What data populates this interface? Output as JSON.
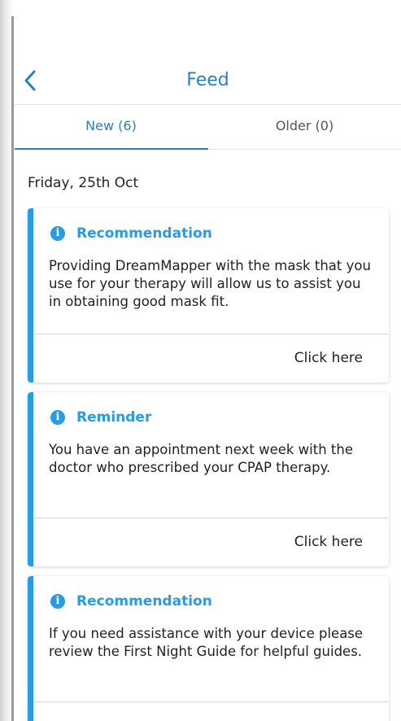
{
  "header": {
    "back_icon": "chevron-left-icon",
    "title": "Feed"
  },
  "tabs": [
    {
      "label": "New (6)",
      "active": true
    },
    {
      "label": "Older (0)",
      "active": false
    }
  ],
  "feed": {
    "date_heading": "Friday, 25th Oct",
    "cards": [
      {
        "type": "Recommendation",
        "icon": "info-icon",
        "body": "Providing DreamMapper with the mask that you use for your therapy will allow us to assist you in obtaining good mask fit.",
        "action": "Click here"
      },
      {
        "type": "Reminder",
        "icon": "info-icon",
        "body": "You have an appointment next week with the doctor who prescribed your CPAP therapy.",
        "action": "Click here"
      },
      {
        "type": "Recommendation",
        "icon": "info-icon",
        "body": "If you need assistance with your device please review the First Night Guide for helpful guides.",
        "action": ""
      }
    ]
  },
  "colors": {
    "brand": "#2a7fbf",
    "accent": "#2a9be0",
    "text": "#222222"
  }
}
